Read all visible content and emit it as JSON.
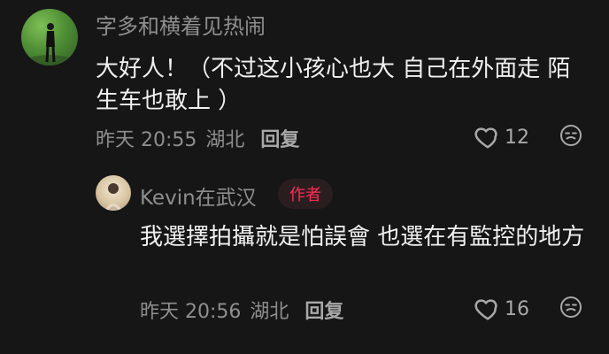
{
  "comments": [
    {
      "username": "字多和横着见热闹",
      "text": "大好人！（不过这小孩心也大 自己在外面走 陌生车也敢上 ）",
      "time": "昨天 20:55",
      "location": "湖北",
      "reply_label": "回复",
      "likes": "12"
    }
  ],
  "replies": [
    {
      "username": "Kevin在武汉",
      "badge": "作者",
      "text": "我選擇拍攝就是怕誤會 也選在有監控的地方",
      "time": "昨天 20:56",
      "location": "湖北",
      "reply_label": "回复",
      "likes": "16"
    }
  ],
  "colors": {
    "background": "#161616",
    "muted_text": "#8e8e8e",
    "author_badge": "#ff2d55"
  },
  "icons": [
    "heart-icon",
    "dislike-face-icon"
  ]
}
